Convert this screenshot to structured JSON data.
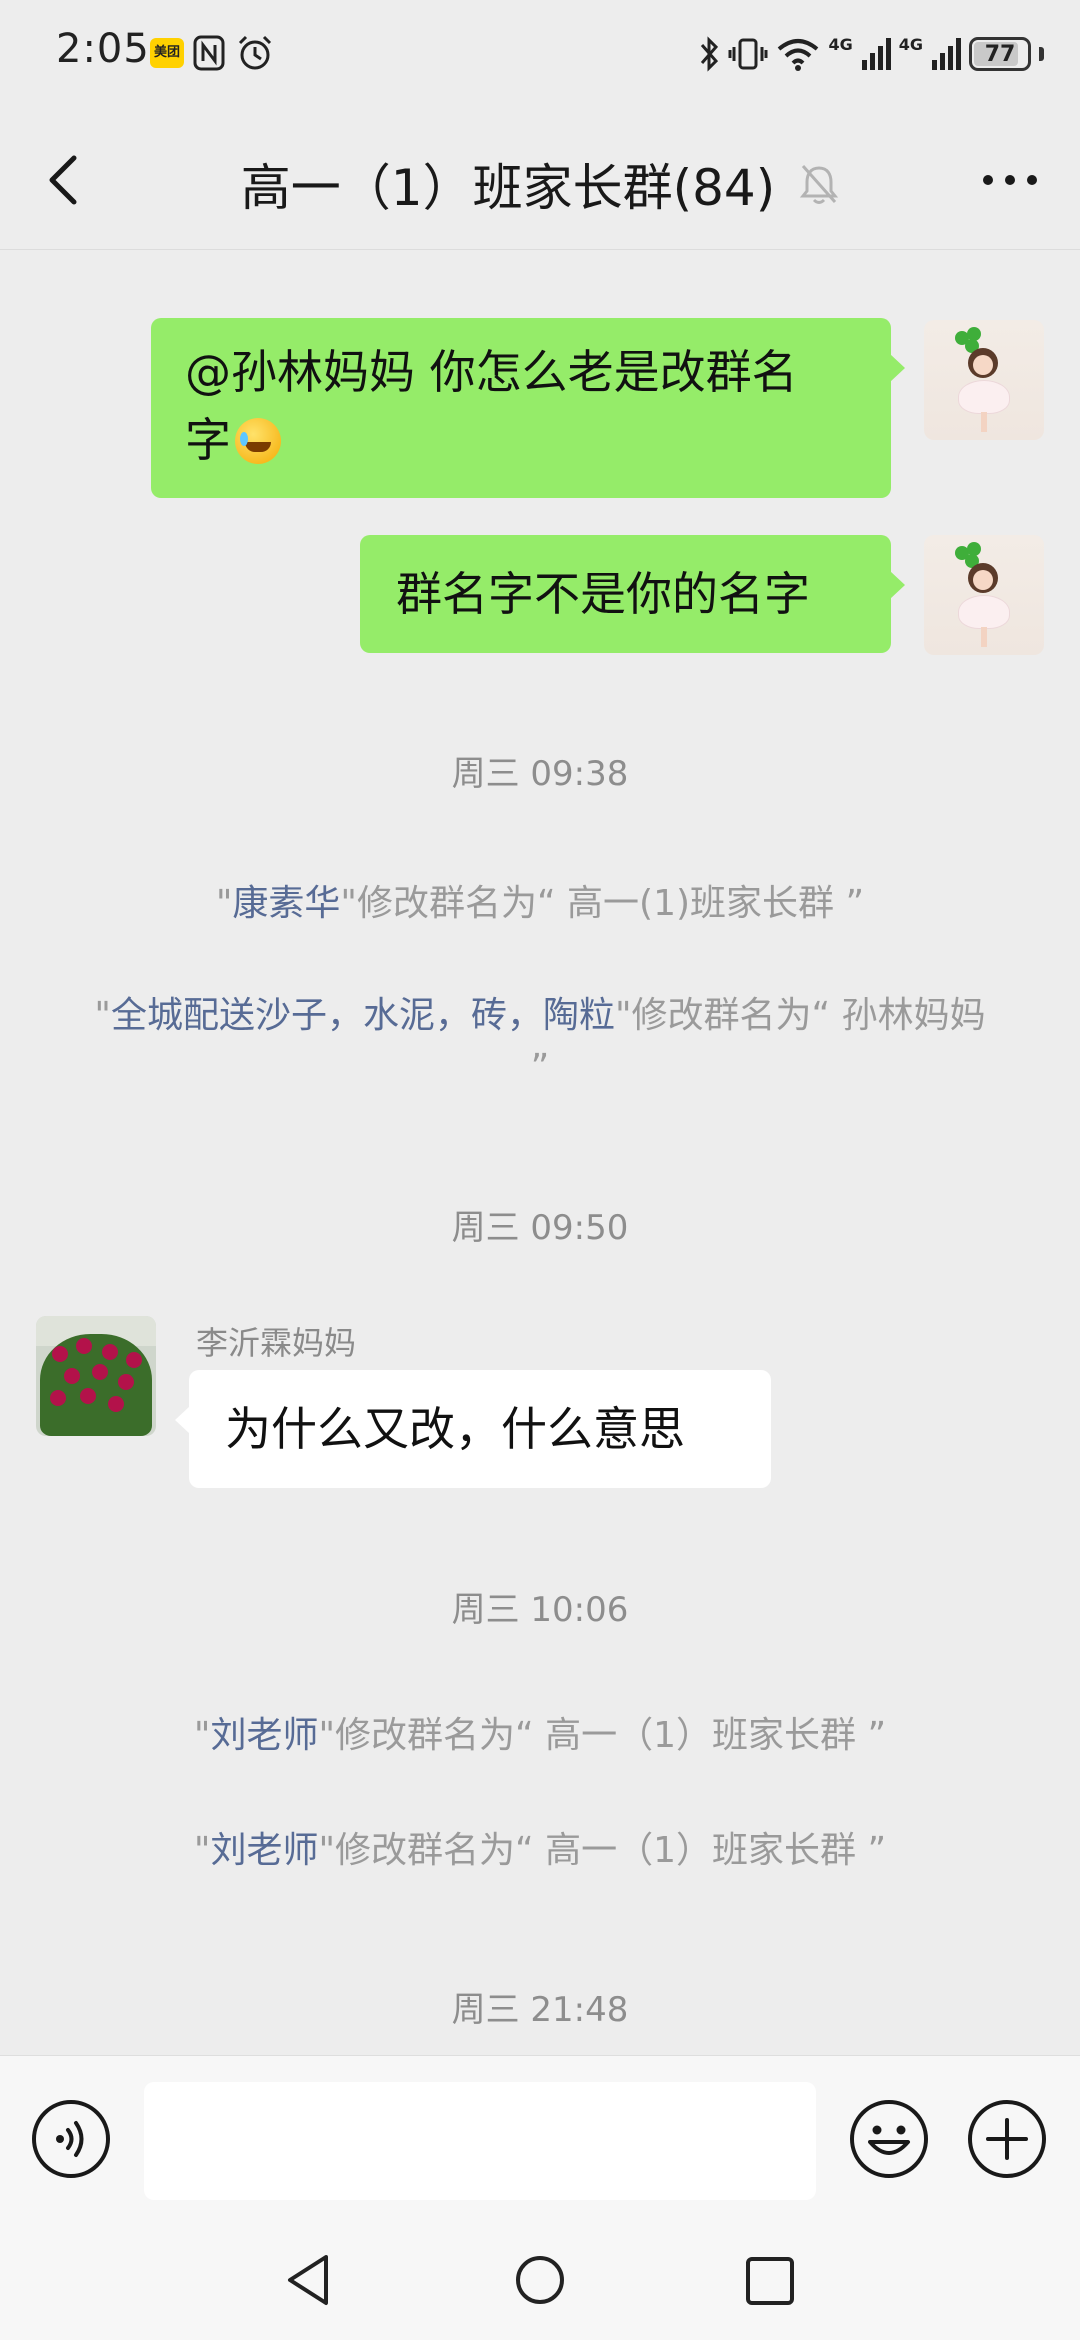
{
  "status_bar": {
    "time": "2:05",
    "meituan_badge": "美团",
    "network_1": "4G",
    "network_2": "4G",
    "battery": "77"
  },
  "header": {
    "title": "高一（1）班家长群(84)"
  },
  "messages": {
    "m1": {
      "prefix": "@孙林妈妈  你怎么老是改群名",
      "line2": "字"
    },
    "m2": {
      "text": "群名字不是你的名字"
    },
    "ts1": "周三 09:38",
    "sys1": {
      "q1": "\"",
      "who": "康素华",
      "rest": "\"修改群名为“ 高一(1)班家长群 ”"
    },
    "sys2": {
      "q1": "\"",
      "who": "全城配送沙子，水泥，砖，陶粒",
      "rest": "\"修改群名为“ 孙林妈妈 ”"
    },
    "ts2": "周三 09:50",
    "m3": {
      "sender": "李沂霖妈妈",
      "text": "为什么又改，什么意思"
    },
    "ts3": "周三 10:06",
    "sys3": {
      "q1": "\"",
      "who": "刘老师",
      "rest": "\"修改群名为“ 高一（1）班家长群 ”"
    },
    "sys4": {
      "q1": "\"",
      "who": "刘老师",
      "rest": "\"修改群名为“ 高一（1）班家长群 ”"
    },
    "ts4": "周三 21:48"
  },
  "input": {
    "value": "",
    "placeholder": ""
  },
  "colors": {
    "background": "#ededed",
    "self_bubble": "#95ec69",
    "other_bubble": "#ffffff",
    "link_name": "#576b95"
  },
  "icons": [
    "back-icon",
    "mute-icon",
    "more-icon",
    "voice-icon",
    "emoji-icon",
    "plus-icon",
    "nav-back-icon",
    "nav-home-icon",
    "nav-recent-icon"
  ]
}
